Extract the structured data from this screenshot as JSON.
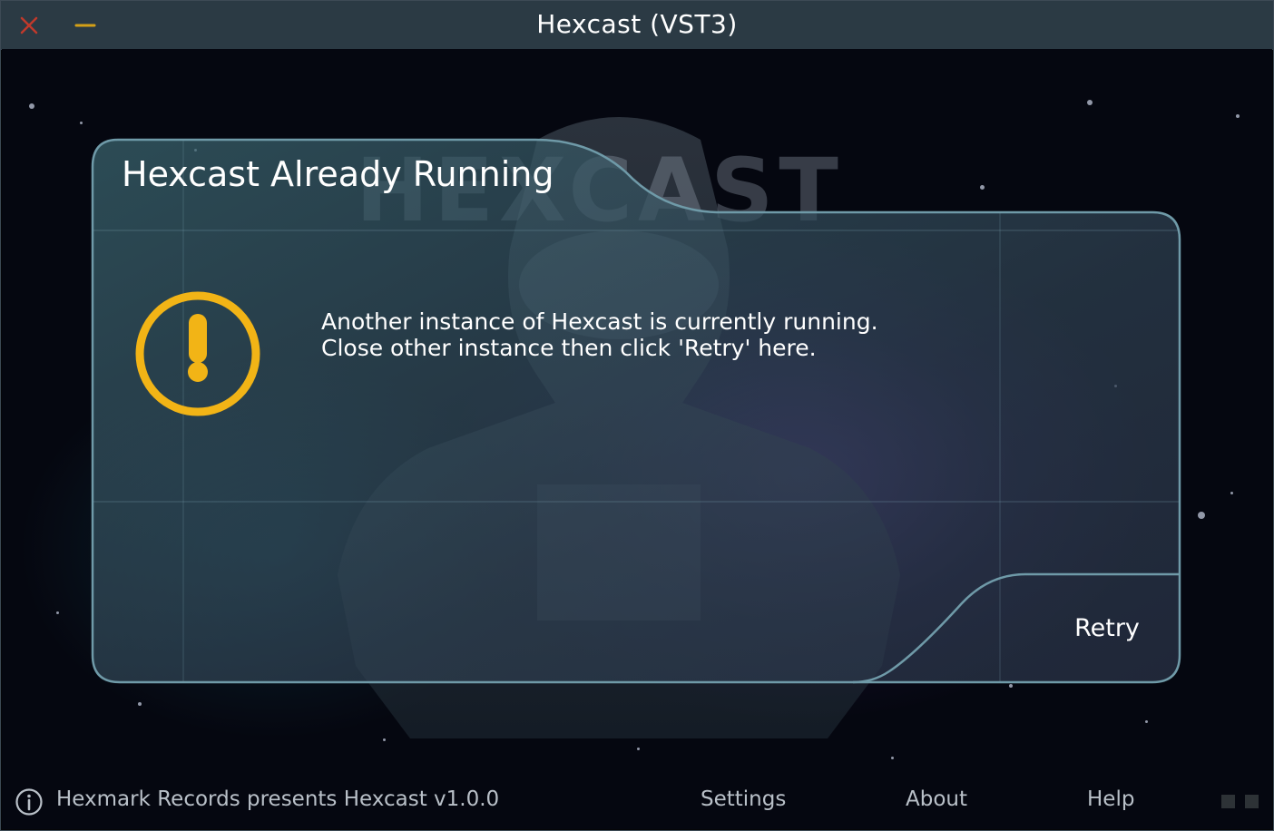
{
  "window": {
    "title": "Hexcast (VST3)"
  },
  "background": {
    "brand_watermark": "HEXCAST"
  },
  "dialog": {
    "title": "Hexcast Already Running",
    "message_line_1": "Another instance of Hexcast is currently running.",
    "message_line_2": "Close other instance then click 'Retry' here.",
    "retry_label": "Retry",
    "icon": "warning-exclamation-icon"
  },
  "footer": {
    "brand_text": "Hexmark Records presents Hexcast v1.0.0",
    "settings_label": "Settings",
    "about_label": "About",
    "help_label": "Help"
  },
  "colors": {
    "titlebar": "#2b3a44",
    "close": "#c0392b",
    "minimize": "#d4a017",
    "warning": "#f2b416",
    "dialog_border": "#6f9aa8"
  }
}
